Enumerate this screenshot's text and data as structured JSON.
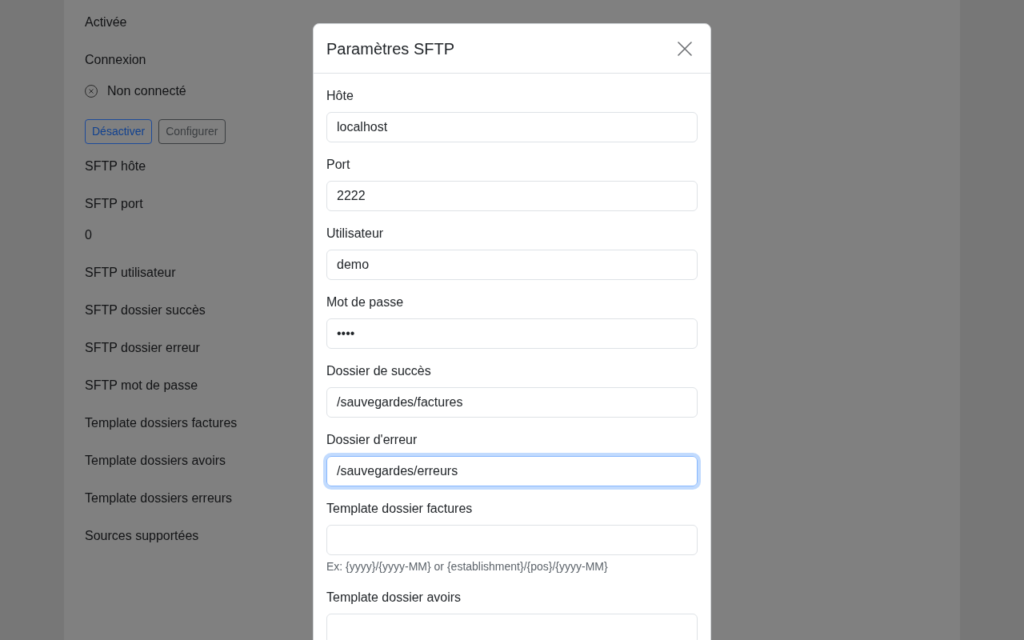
{
  "settings": {
    "enabled_value": "Activée",
    "connection": {
      "label": "Connexion",
      "status": "Non connecté",
      "connected": false
    },
    "buttons": [
      {
        "label": "Désactiver",
        "kind": "primary"
      },
      {
        "label": "Configurer",
        "kind": "secondary"
      }
    ],
    "fields": [
      {
        "label": "SFTP hôte"
      },
      {
        "label": "SFTP port",
        "value": "0"
      },
      {
        "label": "SFTP utilisateur"
      },
      {
        "label": "SFTP dossier succès"
      },
      {
        "label": "SFTP dossier erreur"
      },
      {
        "label": "SFTP mot de passe"
      },
      {
        "label": "Template dossiers factures"
      },
      {
        "label": "Template dossiers avoirs"
      },
      {
        "label": "Template dossiers erreurs"
      },
      {
        "label": "Sources supportées"
      }
    ]
  },
  "dialog": {
    "title": "Paramètres SFTP",
    "fields": [
      {
        "label": "Hôte",
        "value": "localhost",
        "focused": false
      },
      {
        "label": "Port",
        "value": "2222",
        "focused": false
      },
      {
        "label": "Utilisateur",
        "value": "demo",
        "focused": false
      },
      {
        "label": "Mot de passe",
        "value": "••••",
        "focused": false
      },
      {
        "label": "Dossier de succès",
        "value": "/sauvegardes/factures",
        "focused": false
      },
      {
        "label": "Dossier d'erreur",
        "value": "/sauvegardes/erreurs",
        "focused": true
      },
      {
        "label": "Template dossier factures",
        "focused": false,
        "help": "Ex: {yyyy}/{yyyy-MM} or {establishment}/{pos}/{yyyy-MM}"
      },
      {
        "label": "Template dossier avoirs",
        "focused": false
      }
    ]
  }
}
